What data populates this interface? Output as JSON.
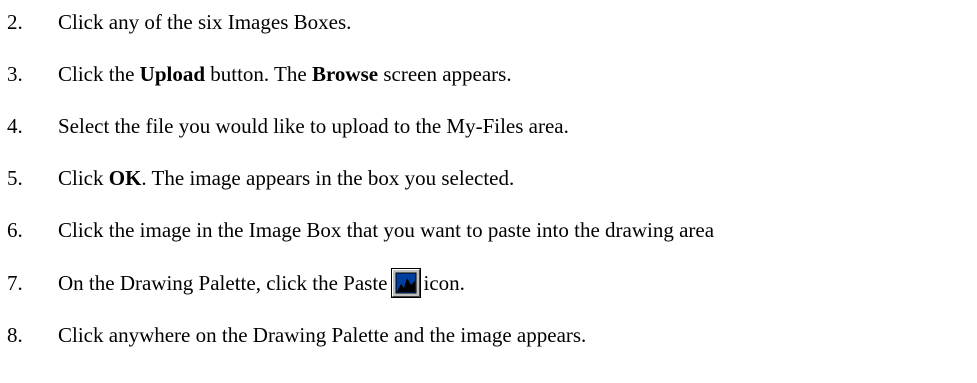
{
  "steps": [
    {
      "number": "2.",
      "text": "Click any of the six Images Boxes."
    },
    {
      "number": "3.",
      "pre": "Click the ",
      "bold1": "Upload",
      "mid": " button. The ",
      "bold2": "Browse",
      "post": " screen appears."
    },
    {
      "number": "4.",
      "text": "Select the file you would like to upload to the My-Files area."
    },
    {
      "number": "5.",
      "pre": "Click ",
      "bold1": "OK",
      "post": ". The image appears in the box you selected."
    },
    {
      "number": "6.",
      "text": "Click the image in the Image Box that you want to paste into the drawing area"
    },
    {
      "number": "7.",
      "pre": "On the Drawing Palette, click the Paste",
      "post": "icon.",
      "icon": "paste-image-icon"
    },
    {
      "number": "8.",
      "text": "Click anywhere on the Drawing Palette and the image appears."
    }
  ]
}
